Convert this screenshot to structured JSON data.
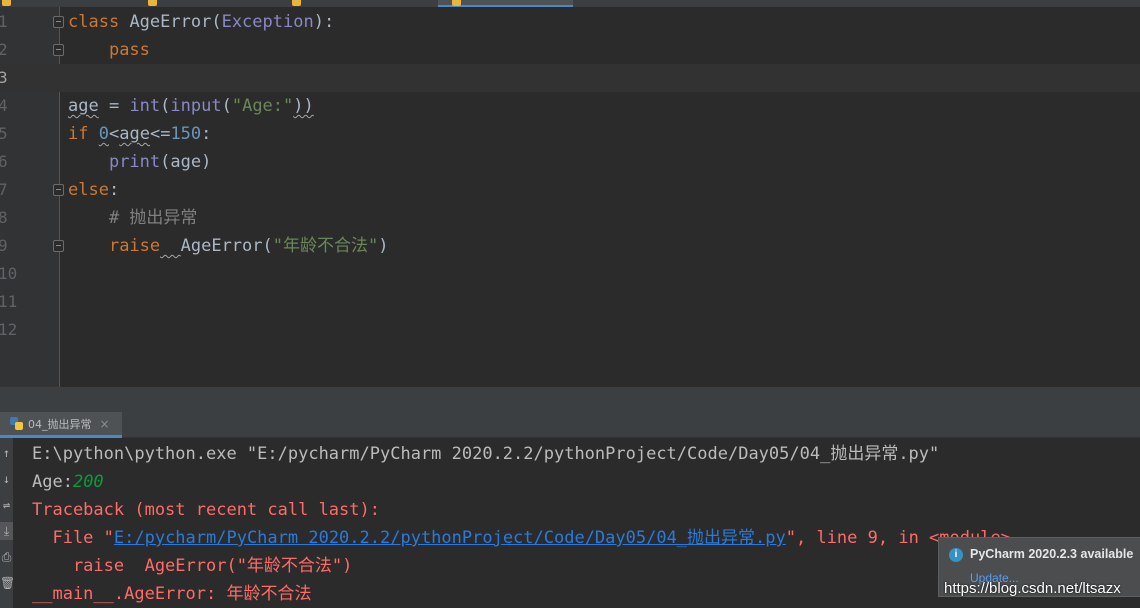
{
  "editor": {
    "line_numbers": [
      "1",
      "2",
      "3",
      "4",
      "5",
      "6",
      "7",
      "8",
      "9",
      "10",
      "11",
      "12"
    ],
    "current_line": 3,
    "code": {
      "l1_kw": "class",
      "l1_name": "AgeError",
      "l1_paren_open": "(",
      "l1_base": "Exception",
      "l1_paren_close": "):",
      "l2_kw": "pass",
      "l4_var": "age",
      "l4_eq": " = ",
      "l4_int": "int",
      "l4_open1": "(",
      "l4_input": "input",
      "l4_open2": "(",
      "l4_str": "\"Age:\"",
      "l4_close": "))",
      "l5_kw": "if",
      "l5_num0": "0",
      "l5_lt": "<",
      "l5_age": "age",
      "l5_le": "<=",
      "l5_num150": "150",
      "l5_colon": ":",
      "l6_print": "print",
      "l6_args": "(age)",
      "l7_kw": "else",
      "l7_colon": ":",
      "l8_comment": "# 抛出异常",
      "l9_kw": "raise",
      "l9_sp": "  ",
      "l9_name": "AgeError(",
      "l9_str": "\"年龄不合法\"",
      "l9_close": ")"
    }
  },
  "run": {
    "tab_label": "04_抛出异常",
    "side_icons": [
      "arrow-up-icon",
      "arrow-down-icon",
      "soft-wrap-icon",
      "scroll-to-end-icon",
      "print-icon",
      "trash-icon"
    ],
    "console": {
      "cmd": "E:\\python\\python.exe \"E:/pycharm/PyCharm 2020.2.2/pythonProject/Code/Day05/04_抛出异常.py\"",
      "prompt": "Age:",
      "user_input": "200",
      "traceback": "Traceback (most recent call last):",
      "file_prefix": "  File \"",
      "file_link": "E:/pycharm/PyCharm 2020.2.2/pythonProject/Code/Day05/04_抛出异常.py",
      "file_suffix": "\", line 9, in <module>",
      "raise_line": "    raise  AgeError(\"年龄不合法\")",
      "error_line": "__main__.AgeError: 年龄不合法"
    }
  },
  "notification": {
    "title": "PyCharm 2020.2.3 available",
    "link": "Update..."
  },
  "watermark": "https://blog.csdn.net/ltsazx"
}
